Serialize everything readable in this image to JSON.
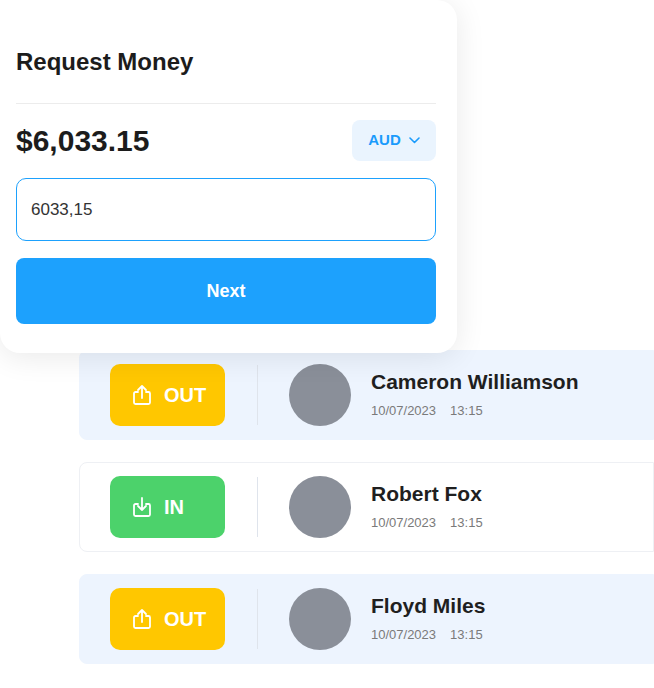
{
  "card": {
    "title": "Request Money",
    "amount": "$6,033.15",
    "currency": "AUD",
    "input_value": "6033,15",
    "button": "Next"
  },
  "transactions": [
    {
      "direction": "OUT",
      "kind": "out",
      "name": "Cameron Williamson",
      "date": "10/07/2023",
      "time": "13:15",
      "selected": true
    },
    {
      "direction": "IN",
      "kind": "in",
      "name": "Robert Fox",
      "date": "10/07/2023",
      "time": "13:15",
      "selected": false
    },
    {
      "direction": "OUT",
      "kind": "out",
      "name": "Floyd Miles",
      "date": "10/07/2023",
      "time": "13:15",
      "selected": true
    }
  ]
}
